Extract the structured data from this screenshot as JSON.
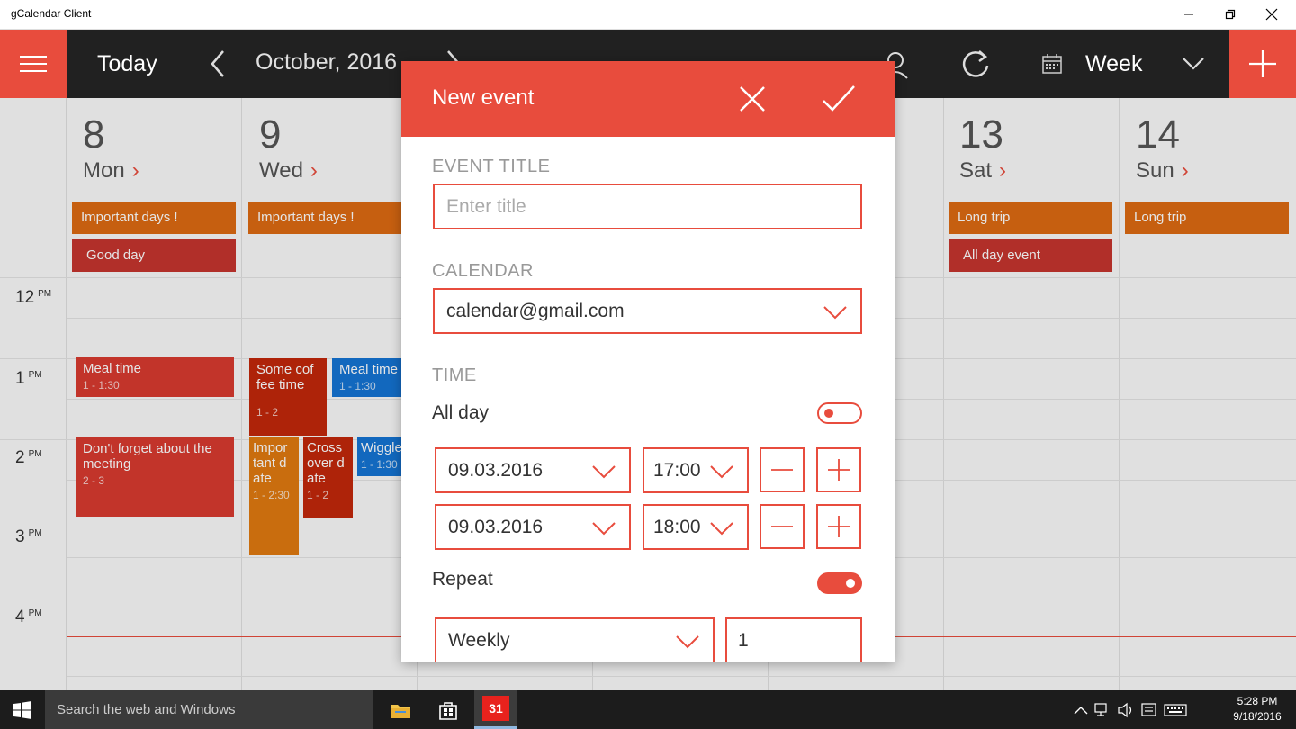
{
  "window": {
    "title": "gCalendar Client"
  },
  "header": {
    "today_label": "Today",
    "month_label": "October, 2016",
    "view_label": "Week",
    "accent": "#e84c3d"
  },
  "calendar": {
    "days": [
      {
        "num": "8",
        "name": "Mon"
      },
      {
        "num": "9",
        "name": "Wed"
      },
      {
        "num": "13",
        "name": "Sat"
      },
      {
        "num": "14",
        "name": "Sun"
      }
    ],
    "allday_events": [
      {
        "title": "Important days !",
        "color": "#dd6a12"
      },
      {
        "title": "Good day",
        "color": "#c6352e"
      },
      {
        "title": "Important days !",
        "color": "#dd6a12"
      },
      {
        "title": "Long trip",
        "color": "#dd6a12"
      },
      {
        "title": "All day event",
        "color": "#c6352e"
      },
      {
        "title": "Long trip",
        "color": "#dd6a12"
      }
    ],
    "hours": [
      {
        "hour": "12",
        "ampm": "PM"
      },
      {
        "hour": "1",
        "ampm": "PM"
      },
      {
        "hour": "2",
        "ampm": "PM"
      },
      {
        "hour": "3",
        "ampm": "PM"
      },
      {
        "hour": "4",
        "ampm": "PM"
      }
    ],
    "events": [
      {
        "title": "Meal time",
        "time": "1 - 1:30",
        "color": "#d93a2f"
      },
      {
        "title": "Don't forget about the meeting",
        "time": "2 - 3",
        "color": "#d93a2f"
      },
      {
        "title": "Some cof fee time",
        "time": "1 - 2",
        "color": "#c2280b"
      },
      {
        "title": "Meal time",
        "time": "1 - 1:30",
        "color": "#1574d4"
      },
      {
        "title": "Impor tant d ate",
        "time": "1 - 2:30",
        "color": "#e07a10"
      },
      {
        "title": "Cross over d ate",
        "time": "1 - 2",
        "color": "#c2280b"
      },
      {
        "title": "Wiggle",
        "time": "1 - 1:30",
        "color": "#1574d4"
      }
    ]
  },
  "dialog": {
    "title": "New event",
    "event_title_label": "EVENT TITLE",
    "event_title_placeholder": "Enter title",
    "calendar_label": "CALENDAR",
    "calendar_value": "calendar@gmail.com",
    "time_label": "TIME",
    "all_day_label": "All day",
    "all_day_on": false,
    "start_date": "09.03.2016",
    "start_time": "17:00",
    "end_date": "09.03.2016",
    "end_time": "18:00",
    "repeat_label": "Repeat",
    "repeat_on": true,
    "repeat_frequency": "Weekly",
    "repeat_interval": "1"
  },
  "taskbar": {
    "search_placeholder": "Search the web and Windows",
    "calendar_app_badge": "31",
    "time": "5:28 PM",
    "date": "9/18/2016"
  }
}
